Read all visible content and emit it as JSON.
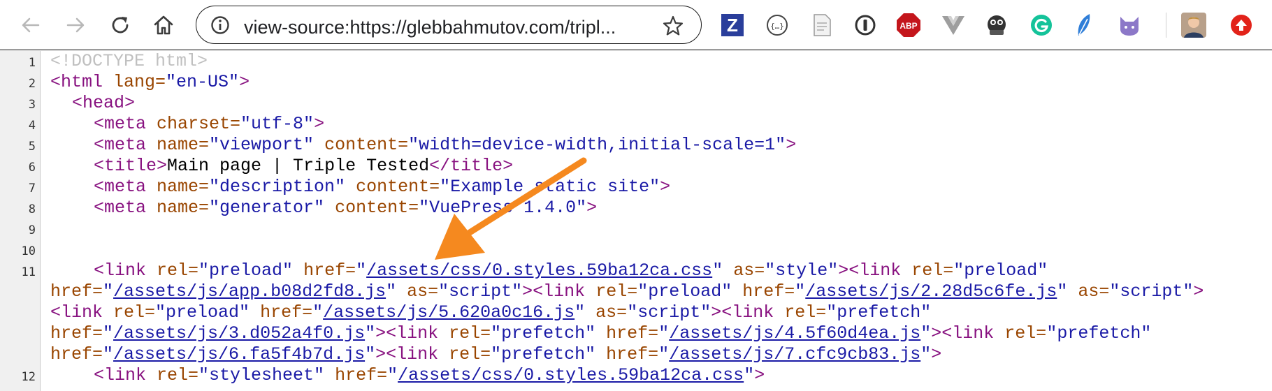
{
  "toolbar": {
    "back_label": "Back",
    "forward_label": "Forward",
    "reload_label": "Reload",
    "home_label": "Home",
    "address": "view-source:https://glebbahmutov.com/tripl..."
  },
  "extensions": [
    "zotero-icon",
    "json-viewer-icon",
    "page-icon",
    "onepassword-icon",
    "adblock-plus-icon",
    "vue-devtools-icon",
    "ext-monster-icon",
    "grammarly-icon",
    "ext-feather-icon",
    "ext-cat-icon",
    "profile-avatar",
    "update-icon"
  ],
  "extension_labels": {
    "abp": "ABP",
    "zotero": "Z"
  },
  "colors": {
    "tag": "#881280",
    "attr": "#994500",
    "value": "#1a1aa6",
    "arrow": "#f5891f",
    "abp": "#c4161c",
    "update": "#e2231a",
    "grammarly": "#15c39a",
    "zotero": "#2a3e9b"
  },
  "source": {
    "line_numbers": [
      "1",
      "2",
      "3",
      "4",
      "5",
      "6",
      "7",
      "8",
      "9",
      "10",
      "11",
      "12"
    ],
    "l1": {
      "doctype": "<!DOCTYPE html>"
    },
    "l2": {
      "t1": "<html",
      "a1": " lang=",
      "v1": "\"en-US\"",
      "t2": ">"
    },
    "l3": {
      "t1": "<head>"
    },
    "l4": {
      "t1": "<meta",
      "a1": " charset=",
      "v1": "\"utf-8\"",
      "t2": ">"
    },
    "l5": {
      "t1": "<meta",
      "a1": " name=",
      "v1": "\"viewport\"",
      "a2": " content=",
      "v2": "\"width=device-width,initial-scale=1\"",
      "t2": ">"
    },
    "l6": {
      "t1": "<title>",
      "text": "Main page | Triple Tested",
      "t2": "</title>"
    },
    "l7": {
      "t1": "<meta",
      "a1": " name=",
      "v1": "\"description\"",
      "a2": " content=",
      "v2": "\"Example static site\"",
      "t2": ">"
    },
    "l8": {
      "t1": "<meta",
      "a1": " name=",
      "v1": "\"generator\"",
      "a2": " content=",
      "v2": "\"VuePress 1.4.0\"",
      "t2": ">"
    },
    "l11a": {
      "t1": "<link",
      "a1": " rel=",
      "v1": "\"preload\"",
      "a2": " href=",
      "q1": "\"",
      "href1": "/assets/css/0.styles.59ba12ca.css",
      "q2": "\"",
      "a3": " as=",
      "v3": "\"style\"",
      "t2": "><link",
      "a4": " rel=",
      "v4": "\"preload\""
    },
    "l11b": {
      "a1": "href=",
      "q1": "\"",
      "href1": "/assets/js/app.b08d2fd8.js",
      "q2": "\"",
      "a2": " as=",
      "v2": "\"script\"",
      "t1": "><link",
      "a3": " rel=",
      "v3": "\"preload\"",
      "a4": " href=",
      "q3": "\"",
      "href2": "/assets/js/2.28d5c6fe.js",
      "q4": "\"",
      "a5": " as=",
      "v5": "\"script\"",
      "t2": ">"
    },
    "l11c": {
      "t1": "<link",
      "a1": " rel=",
      "v1": "\"preload\"",
      "a2": " href=",
      "q1": "\"",
      "href1": "/assets/js/5.620a0c16.js",
      "q2": "\"",
      "a3": " as=",
      "v3": "\"script\"",
      "t2": "><link",
      "a4": " rel=",
      "v4": "\"prefetch\""
    },
    "l11d": {
      "a1": "href=",
      "q1": "\"",
      "href1": "/assets/js/3.d052a4f0.js",
      "q2": "\"",
      "t1": "><link",
      "a2": " rel=",
      "v2": "\"prefetch\"",
      "a3": " href=",
      "q3": "\"",
      "href2": "/assets/js/4.5f60d4ea.js",
      "q4": "\"",
      "t2": "><link",
      "a4": " rel=",
      "v4": "\"prefetch\""
    },
    "l11e": {
      "a1": "href=",
      "q1": "\"",
      "href1": "/assets/js/6.fa5f4b7d.js",
      "q2": "\"",
      "t1": "><link",
      "a2": " rel=",
      "v2": "\"prefetch\"",
      "a3": " href=",
      "q3": "\"",
      "href2": "/assets/js/7.cfc9cb83.js",
      "q4": "\"",
      "t2": ">"
    },
    "l12": {
      "t1": "<link",
      "a1": " rel=",
      "v1": "\"stylesheet\"",
      "a2": " href=",
      "q1": "\"",
      "href1": "/assets/css/0.styles.59ba12ca.css",
      "q2": "\"",
      "t2": ">"
    }
  }
}
